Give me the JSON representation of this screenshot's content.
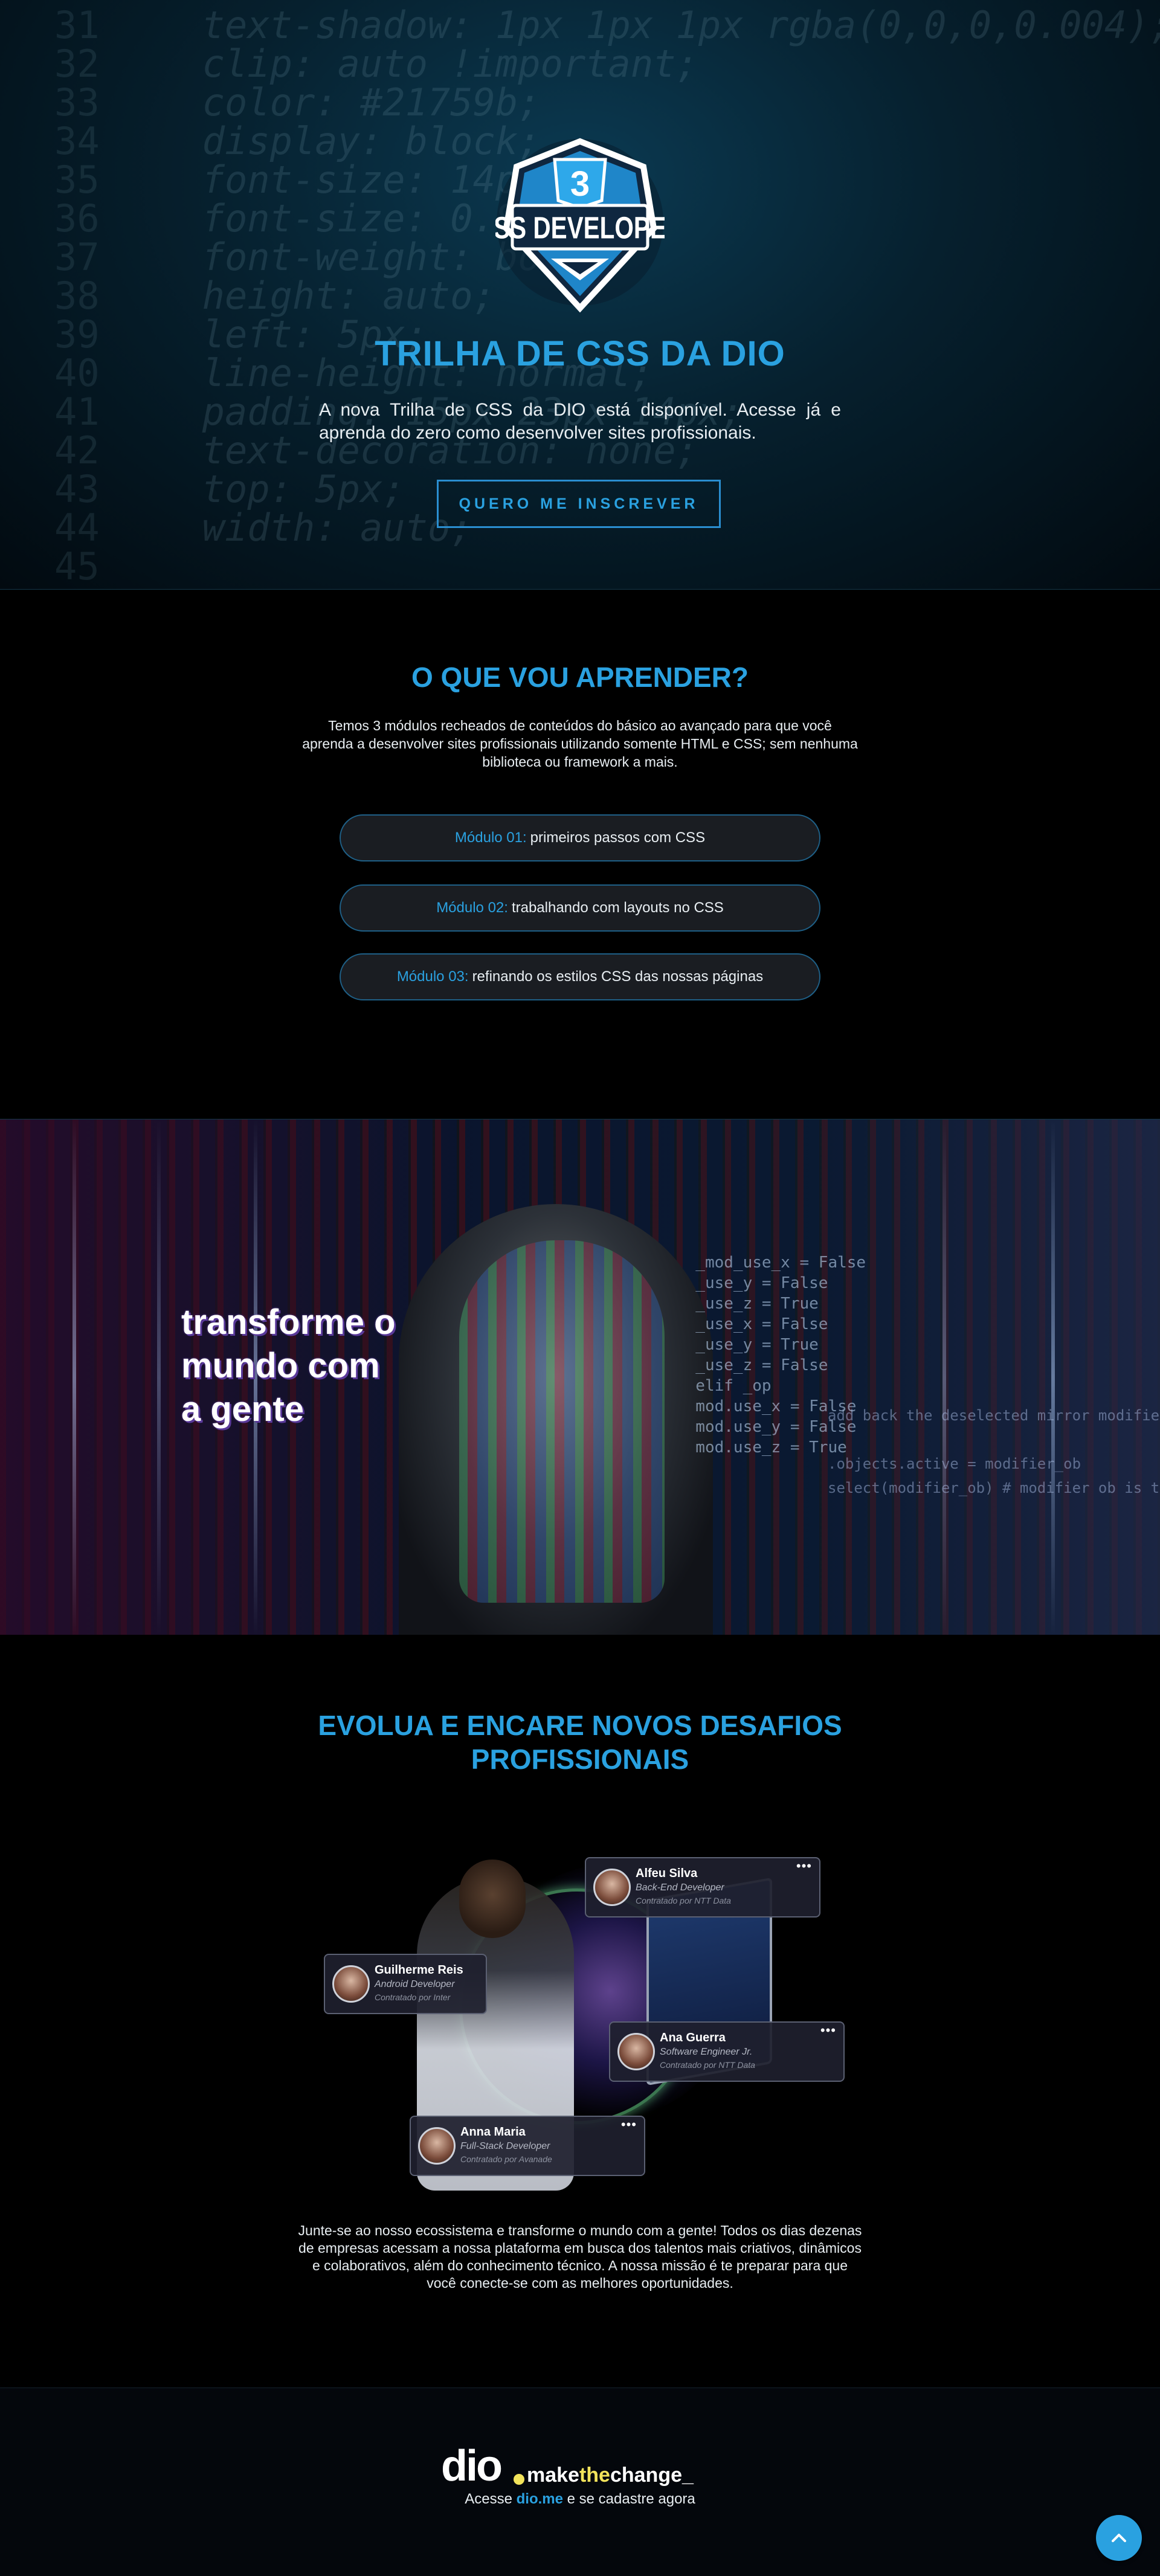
{
  "hero": {
    "code_lines": [
      {
        "n": "31",
        "t": "  text-shadow: 1px 1px 1px rgba(0,0,0,0.004);"
      },
      {
        "n": "32",
        "t": "  clip: auto !important;"
      },
      {
        "n": "33",
        "t": "  color: #21759b;"
      },
      {
        "n": "34",
        "t": "  display: block;"
      },
      {
        "n": "35",
        "t": "  font-size: 14px;"
      },
      {
        "n": "36",
        "t": "  font-size: 0.875rem;"
      },
      {
        "n": "37",
        "t": "  font-weight: bold;"
      },
      {
        "n": "38",
        "t": "  height: auto;"
      },
      {
        "n": "39",
        "t": "  left: 5px;"
      },
      {
        "n": "40",
        "t": "  line-height: normal;"
      },
      {
        "n": "41",
        "t": "  padding: 15px 23px 14px;"
      },
      {
        "n": "42",
        "t": "  text-decoration: none;"
      },
      {
        "n": "43",
        "t": "  top: 5px;"
      },
      {
        "n": "44",
        "t": "  width: auto;"
      },
      {
        "n": "45",
        "t": ""
      }
    ],
    "badge_text": "CSS DEVELOPER",
    "badge_number": "3",
    "title": "TRILHA DE CSS DA DIO",
    "text": "A nova Trilha de CSS da DIO está disponível. Acesse já e aprenda do zero como desenvolver sites profissionais.",
    "button_label": "QUERO ME INSCREVER"
  },
  "learn": {
    "title": "O QUE VOU APRENDER?",
    "text": "Temos 3 módulos recheados de conteúdos do básico ao avançado para que você aprenda a desenvolver sites profissionais utilizando somente HTML e CSS; sem nenhuma biblioteca ou framework a mais.",
    "modules": [
      {
        "num": "Módulo 01:",
        "label": "primeiros passos com CSS"
      },
      {
        "num": "Módulo 02:",
        "label": "trabalhando com layouts no CSS"
      },
      {
        "num": "Módulo 03:",
        "label": "refinando os estilos CSS das nossas páginas"
      }
    ]
  },
  "banner": {
    "text_lines": [
      "transforme o",
      "mundo com",
      "a gente"
    ],
    "code_lines": "  _mod_use_x = False\n  _use_y = False\n  _use_z = True\n  _use_x = False\n  _use_y = True\n  _use_z = False\n  elif _op\n  mod.use_x = False\n  mod.use_y = False\n  mod.use_z = True",
    "code_lines2": "add back the deselected mirror modifier o\n\n.objects.active = modifier_ob\nselect(modifier_ob) # modifier ob is the active ob"
  },
  "evolve": {
    "title": "EVOLUA E ENCARE NOVOS DESAFIOS PROFISSIONAIS",
    "cards": [
      {
        "name": "Alfeu Silva",
        "role": "Back-End Developer",
        "company": "Contratado por NTT Data"
      },
      {
        "name": "Guilherme Reis",
        "role": "Android Developer",
        "company": "Contratado por Inter"
      },
      {
        "name": "Ana Guerra",
        "role": "Software Engineer Jr.",
        "company": "Contratado por NTT Data"
      },
      {
        "name": "Anna Maria",
        "role": "Full-Stack Developer",
        "company": "Contratado por Avanade"
      }
    ],
    "text": "Junte-se ao nosso ecossistema e transforme o mundo com a gente! Todos os dias dezenas de empresas acessam a nossa plataforma em busca dos talentos mais criativos, dinâmicos e colaborativos, além do conhecimento técnico. A nossa missão é te preparar para que você conecte-se com as melhores oportunidades."
  },
  "footer": {
    "logo_dio": "dio",
    "logo_make": "make",
    "logo_the": "the",
    "logo_change": "change_",
    "text_before": "Acesse ",
    "link": "dio.me",
    "text_after": " e se cadastre agora"
  },
  "icons": {
    "badge": "css3-shield-icon",
    "more": "more-dots-icon",
    "scroll_top": "chevron-up-icon"
  },
  "colors": {
    "accent": "#2aa1e0",
    "logo_yellow": "#f2e35b",
    "background": "#000000"
  }
}
